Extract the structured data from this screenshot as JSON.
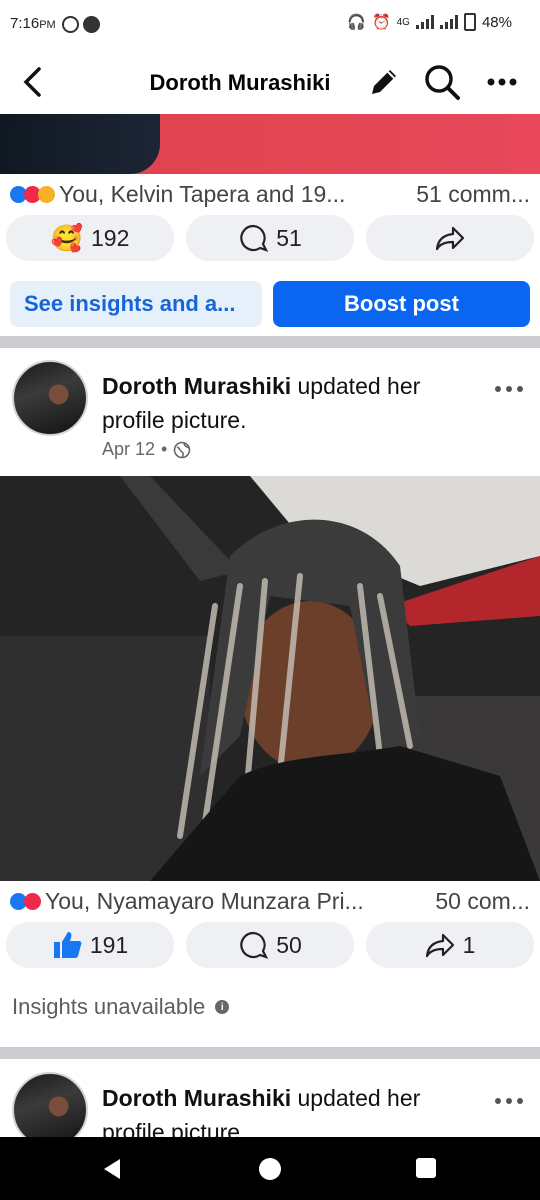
{
  "status_bar": {
    "time": "7:16",
    "ampm": "PM",
    "network": "4G",
    "battery": "48%"
  },
  "header": {
    "title": "Doroth Murashiki",
    "back_icon": "back-arrow-icon",
    "edit_icon": "pencil-icon",
    "search_icon": "search-icon",
    "more_icon": "more-icon"
  },
  "post1": {
    "reactions_text": "You, Kelvin Tapera and 19...",
    "comments_text": "51 comm...",
    "react_count": "192",
    "comment_count": "51",
    "insights_label": "See insights and a...",
    "boost_label": "Boost post"
  },
  "post2": {
    "author": "Doroth Murashiki",
    "action": "updated her profile picture.",
    "date": "Apr 12",
    "dot": "•",
    "reactions_text": "You, Nyamayaro Munzara Pri...",
    "comments_text": "50 com...",
    "like_count": "191",
    "comment_count": "50",
    "share_count": "1",
    "insights_text": "Insights unavailable"
  },
  "post3": {
    "author": "Doroth Murashiki",
    "action": "updated her profile picture."
  },
  "colors": {
    "brand_blue": "#0a66f0",
    "pill_bg": "#eef0f3",
    "divider": "#cbcdd1"
  }
}
